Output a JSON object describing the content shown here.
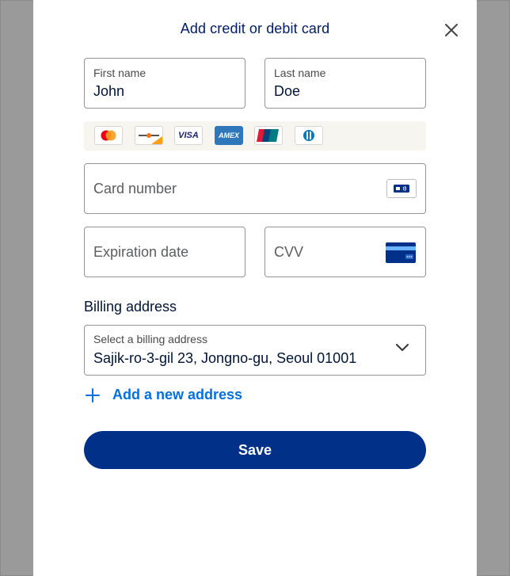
{
  "dialog": {
    "title": "Add credit or debit card"
  },
  "first_name": {
    "label": "First name",
    "value": "John"
  },
  "last_name": {
    "label": "Last name",
    "value": "Doe"
  },
  "card_brands": [
    "mastercard-icon",
    "discover-icon",
    "visa-icon",
    "amex-icon",
    "unionpay-icon",
    "diners-club-icon"
  ],
  "brand_text": {
    "visa": "VISA",
    "amex": "AMEX"
  },
  "card_number": {
    "placeholder": "Card number"
  },
  "expiration": {
    "placeholder": "Expiration date"
  },
  "cvv": {
    "placeholder": "CVV"
  },
  "billing": {
    "section_label": "Billing address",
    "select_label": "Select a billing address",
    "selected_value": "Sajik-ro-3-gil 23, Jongno-gu, Seoul 01001",
    "add_new_label": "Add a new address"
  },
  "save_label": "Save",
  "colors": {
    "primary": "#003087",
    "link": "#0070e0",
    "title": "#001c64",
    "overlay": "#9a9a9a"
  }
}
